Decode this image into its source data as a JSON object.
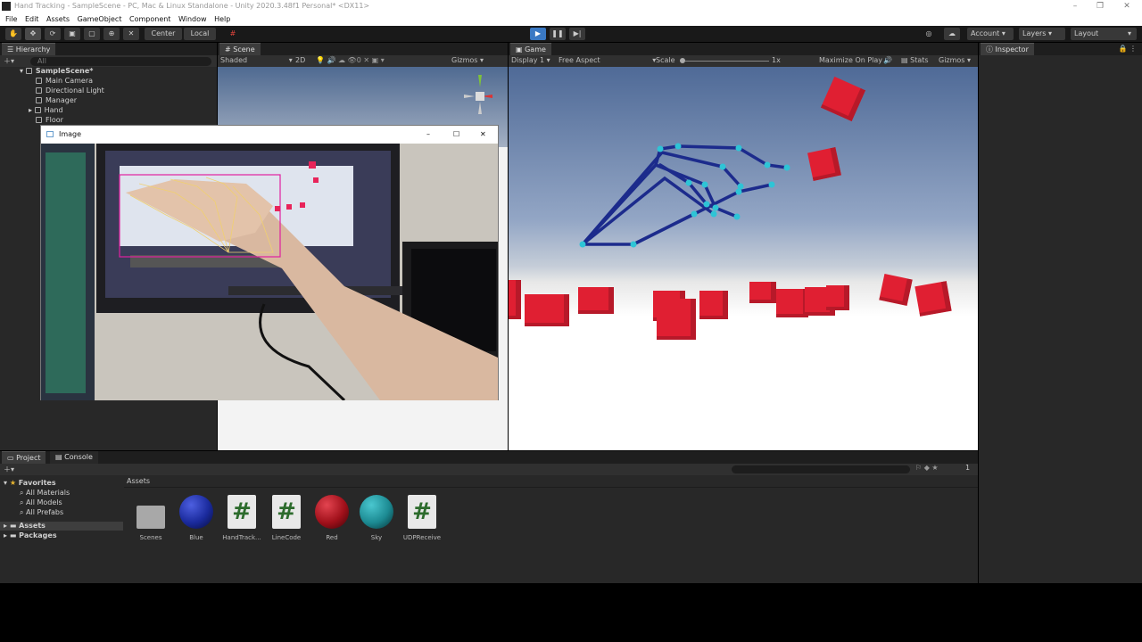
{
  "window": {
    "title": "Hand Tracking - SampleScene - PC, Mac & Linux Standalone - Unity 2020.3.48f1 Personal* <DX11>",
    "controls": [
      "–",
      "❐",
      "✕"
    ]
  },
  "menu": [
    "File",
    "Edit",
    "Assets",
    "GameObject",
    "Component",
    "Window",
    "Help"
  ],
  "toolbar": {
    "center_label": "Center",
    "local_label": "Local",
    "account_label": "Account",
    "layers_label": "Layers",
    "layout_label": "Layout"
  },
  "hierarchy": {
    "tab": "Hierarchy",
    "search_placeholder": "All",
    "scene": "SampleScene*",
    "items": [
      "Main Camera",
      "Directional Light",
      "Manager",
      "Hand",
      "Floor"
    ]
  },
  "scene_view": {
    "tab": "Scene",
    "shading": "Shaded",
    "mode_2d": "2D",
    "gizmos": "Gizmos"
  },
  "image_window": {
    "title": "Image"
  },
  "game_view": {
    "tab": "Game",
    "display": "Display 1",
    "aspect": "Free Aspect",
    "scale_label": "Scale",
    "scale_value": "1x",
    "maximize": "Maximize On Play",
    "stats": "Stats",
    "gizmos": "Gizmos"
  },
  "inspector": {
    "tab": "Inspector"
  },
  "project": {
    "tab_project": "Project",
    "tab_console": "Console",
    "favorites_label": "Favorites",
    "favorites": [
      "All Materials",
      "All Models",
      "All Prefabs"
    ],
    "roots": [
      "Assets",
      "Packages"
    ],
    "breadcrumb": "Assets",
    "count_badge": "1",
    "assets": [
      {
        "name": "Scenes",
        "kind": "folder-icon"
      },
      {
        "name": "Blue",
        "kind": "material-sphere",
        "color": "#1a2a9c"
      },
      {
        "name": "HandTrack...",
        "kind": "script-icon"
      },
      {
        "name": "LineCode",
        "kind": "script-icon"
      },
      {
        "name": "Red",
        "kind": "material-sphere",
        "color": "#a0101a"
      },
      {
        "name": "Sky",
        "kind": "material-sphere",
        "color": "#1c8a92"
      },
      {
        "name": "UDPReceive",
        "kind": "script-icon"
      }
    ]
  },
  "colors": {
    "editor_bg": "#282828",
    "play_active": "#3a79c4",
    "cube_red": "#e01f32",
    "hand_skeleton": "#1c2b8c",
    "hand_joint": "#2ec4d6"
  }
}
